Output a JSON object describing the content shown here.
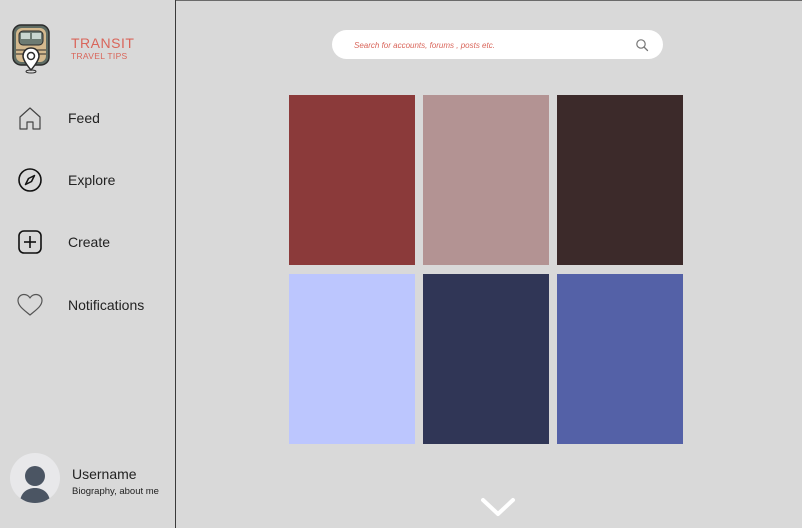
{
  "brand": {
    "title": "TRANSIT",
    "subtitle": "TRAVEL TIPS",
    "color": "#d9655a",
    "icon": "transit-logo-icon"
  },
  "sidebar": {
    "items": [
      {
        "label": "Feed",
        "icon": "home-icon"
      },
      {
        "label": "Explore",
        "icon": "compass-icon"
      },
      {
        "label": "Create",
        "icon": "plus-square-icon"
      },
      {
        "label": "Notifications",
        "icon": "heart-icon"
      }
    ]
  },
  "profile": {
    "username": "Username",
    "bio": "Biography, about me",
    "icon": "user-avatar-icon"
  },
  "search": {
    "placeholder": "Search for accounts, forums , posts etc.",
    "value": "",
    "icon": "search-icon"
  },
  "grid": {
    "tiles": [
      {
        "color": "#8b3a3a"
      },
      {
        "color": "#b39393"
      },
      {
        "color": "#3c2a2a"
      },
      {
        "color": "#bcc6fe"
      },
      {
        "color": "#303656"
      },
      {
        "color": "#5461a7"
      }
    ]
  },
  "more": {
    "icon": "chevron-down-icon"
  }
}
